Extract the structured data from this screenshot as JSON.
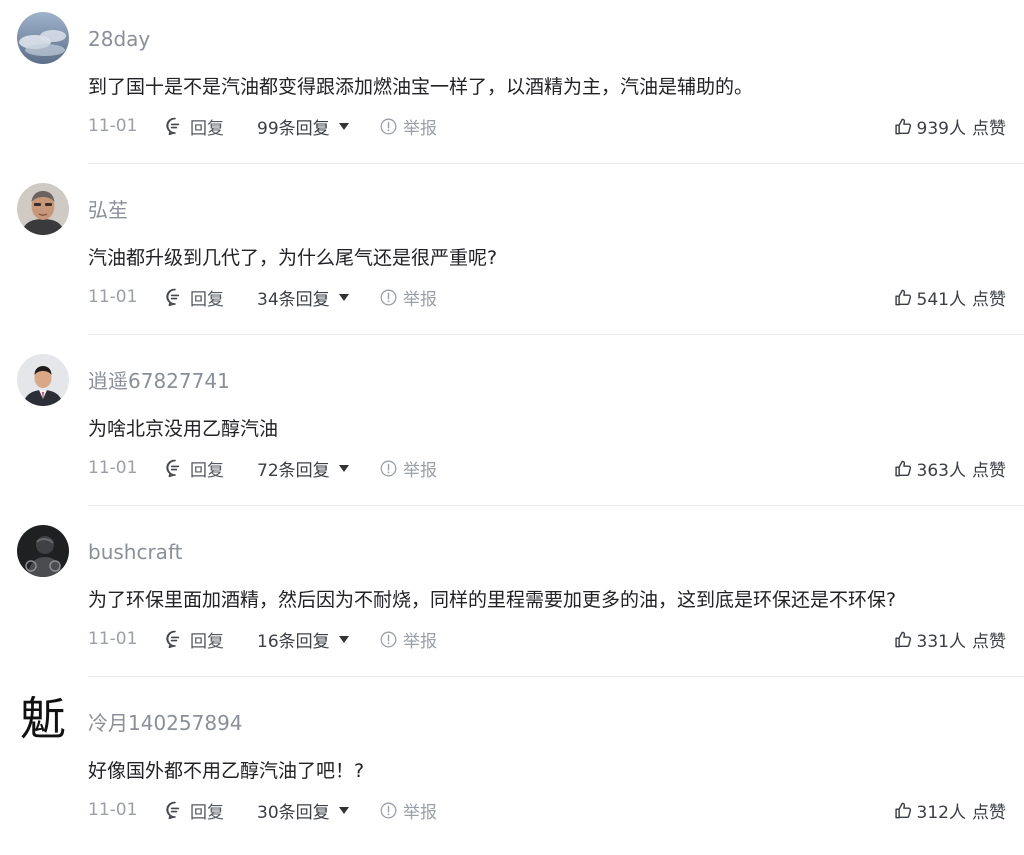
{
  "comments": [
    {
      "username": "28day",
      "text": "到了国十是不是汽油都变得跟添加燃油宝一样了，以酒精为主，汽油是辅助的。",
      "date": "11-01",
      "reply_label": "回复",
      "reply_count": "99条回复",
      "report_label": "举报",
      "likes": "939人",
      "like_label": "点赞"
    },
    {
      "username": "弘苼",
      "text": "汽油都升级到几代了，为什么尾气还是很严重呢?",
      "date": "11-01",
      "reply_label": "回复",
      "reply_count": "34条回复",
      "report_label": "举报",
      "likes": "541人",
      "like_label": "点赞"
    },
    {
      "username": "逍遥67827741",
      "text": "为啥北京没用乙醇汽油",
      "date": "11-01",
      "reply_label": "回复",
      "reply_count": "72条回复",
      "report_label": "举报",
      "likes": "363人",
      "like_label": "点赞"
    },
    {
      "username": "bushcraft",
      "text": "为了环保里面加酒精，然后因为不耐烧，同样的里程需要加更多的油，这到底是环保还是不环保?",
      "date": "11-01",
      "reply_label": "回复",
      "reply_count": "16条回复",
      "report_label": "举报",
      "likes": "331人",
      "like_label": "点赞"
    },
    {
      "username": "冷月140257894",
      "avatar_char": "鬿",
      "text": "好像国外都不用乙醇汽油了吧！?",
      "date": "11-01",
      "reply_label": "回复",
      "reply_count": "30条回复",
      "report_label": "举报",
      "likes": "312人",
      "like_label": "点赞"
    }
  ]
}
